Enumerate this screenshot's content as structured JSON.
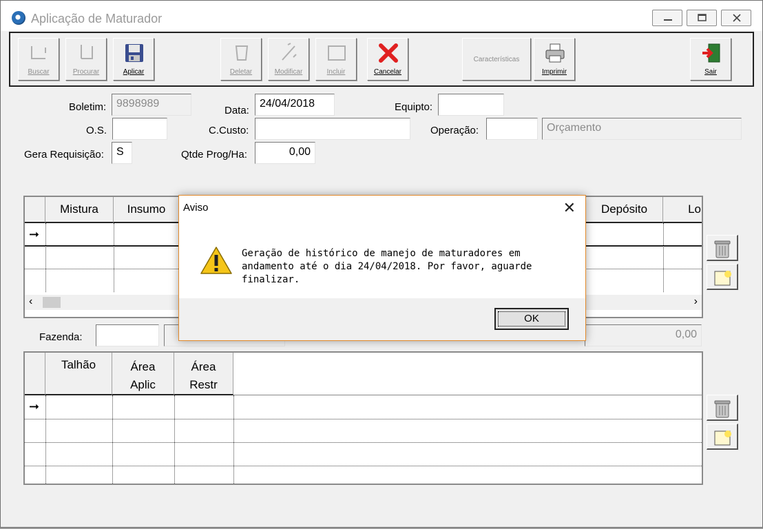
{
  "window": {
    "title": "Aplicação de Maturador"
  },
  "toolbar": {
    "buscar": "Buscar",
    "procurar": "Procurar",
    "aplicar": "Aplicar",
    "deletar": "Deletar",
    "modificar": "Modificar",
    "incluir": "Incluir",
    "cancelar": "Cancelar",
    "caracteristicas": "Características",
    "imprimir": "Imprimir",
    "sair": "Sair"
  },
  "form": {
    "boletim_label": "Boletim:",
    "boletim_value": "9898989",
    "data_label": "Data:",
    "data_value": "24/04/2018",
    "equipto_label": "Equipto:",
    "equipto_value": "",
    "os_label": "O.S.",
    "os_value": "",
    "ccusto_label": "C.Custo:",
    "ccusto_value": "",
    "operacao_label": "Operação:",
    "operacao_code": "",
    "operacao_desc": "Orçamento",
    "gera_label": "Gera Requisição:",
    "gera_value": "S",
    "qtde_label": "Qtde Prog/Ha:",
    "qtde_value": "0,00",
    "fazenda_label": "Fazenda:",
    "fazenda_value": "",
    "total_value": "0,00"
  },
  "grid1": {
    "col_mistura": "Mistura",
    "col_insumo": "Insumo",
    "col_deposito": "Depósito",
    "col_lo": "Lo"
  },
  "grid2": {
    "col_talhao": "Talhão",
    "col_area_aplic_1": "Área",
    "col_area_aplic_2": "Aplic",
    "col_area_restr_1": "Área",
    "col_area_restr_2": "Restr"
  },
  "dialog": {
    "title": "Aviso",
    "line1": "Geração de histórico de manejo de maturadores em",
    "line2": "andamento até o dia 24/04/2018. Por favor, aguarde finalizar.",
    "ok": "OK"
  },
  "colors": {
    "accent_orange": "#e38a2a",
    "cancel_red": "#e02020"
  }
}
